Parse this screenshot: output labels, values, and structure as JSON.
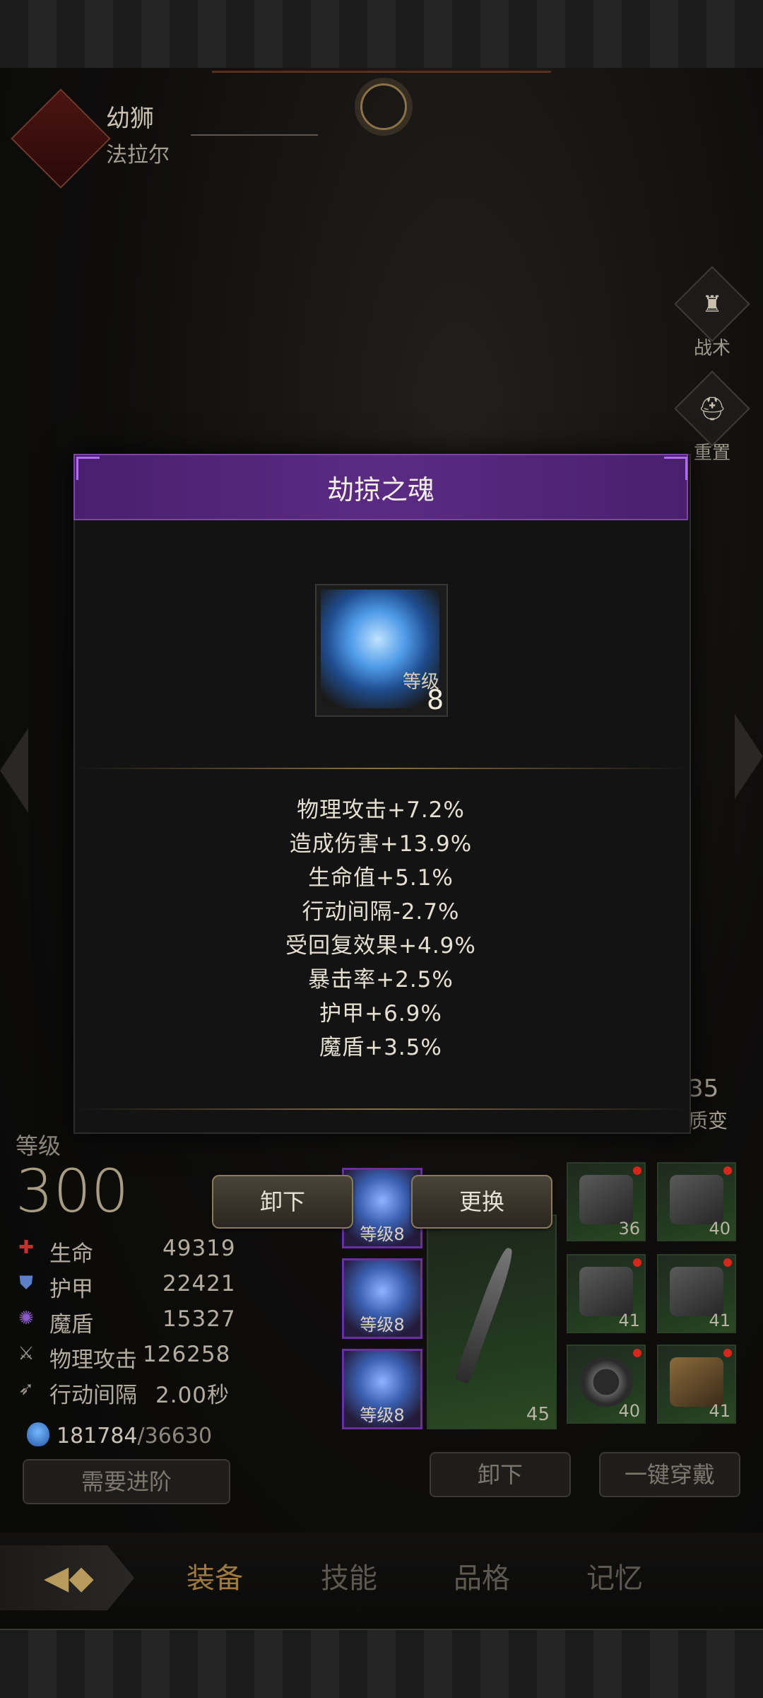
{
  "hero": {
    "name": "幼狮",
    "subtitle": "法拉尔"
  },
  "side_buttons": {
    "tactics": "战术",
    "reset": "重置"
  },
  "stats_panel": {
    "level_label": "等级",
    "level_value": "300",
    "stats": [
      {
        "name": "生命",
        "value": "49319",
        "icon": "cross-icon",
        "color": "#c9302c"
      },
      {
        "name": "护甲",
        "value": "22421",
        "icon": "shield-icon",
        "color": "#5b7fc9"
      },
      {
        "name": "魔盾",
        "value": "15327",
        "icon": "swirl-icon",
        "color": "#8b5bc9"
      },
      {
        "name": "物理攻击",
        "value": "126258",
        "icon": "sword-icon",
        "color": "#9e978b"
      },
      {
        "name": "行动间隔",
        "value": "2.00秒",
        "icon": "wing-icon",
        "color": "#9e978b"
      }
    ],
    "soul_current": "181784",
    "soul_max": "/36630",
    "advance_button": "需要进阶"
  },
  "equipment": {
    "soul_slots": [
      {
        "level": "等级8"
      },
      {
        "level": "等级8"
      },
      {
        "level": "等级8"
      }
    ],
    "weapon_level": "45",
    "slots": [
      "36",
      "40",
      "41",
      "41",
      "40",
      "41"
    ],
    "unequip_button": "卸下",
    "equip_all_button": "一键穿戴",
    "partial_level": "35",
    "partial_label": "质变"
  },
  "popup": {
    "title": "劫掠之魂",
    "item_level_label": "等级",
    "item_level_value": "8",
    "stats": [
      "物理攻击+7.2%",
      "造成伤害+13.9%",
      "生命值+5.1%",
      "行动间隔-2.7%",
      "受回复效果+4.9%",
      "暴击率+2.5%",
      "护甲+6.9%",
      "魔盾+3.5%"
    ],
    "unequip_button": "卸下",
    "replace_button": "更换",
    "accent_color": "#5b2b83"
  },
  "nav": {
    "back_icon": "back-diamond-icon",
    "tabs": [
      "装备",
      "技能",
      "品格",
      "记忆"
    ]
  }
}
